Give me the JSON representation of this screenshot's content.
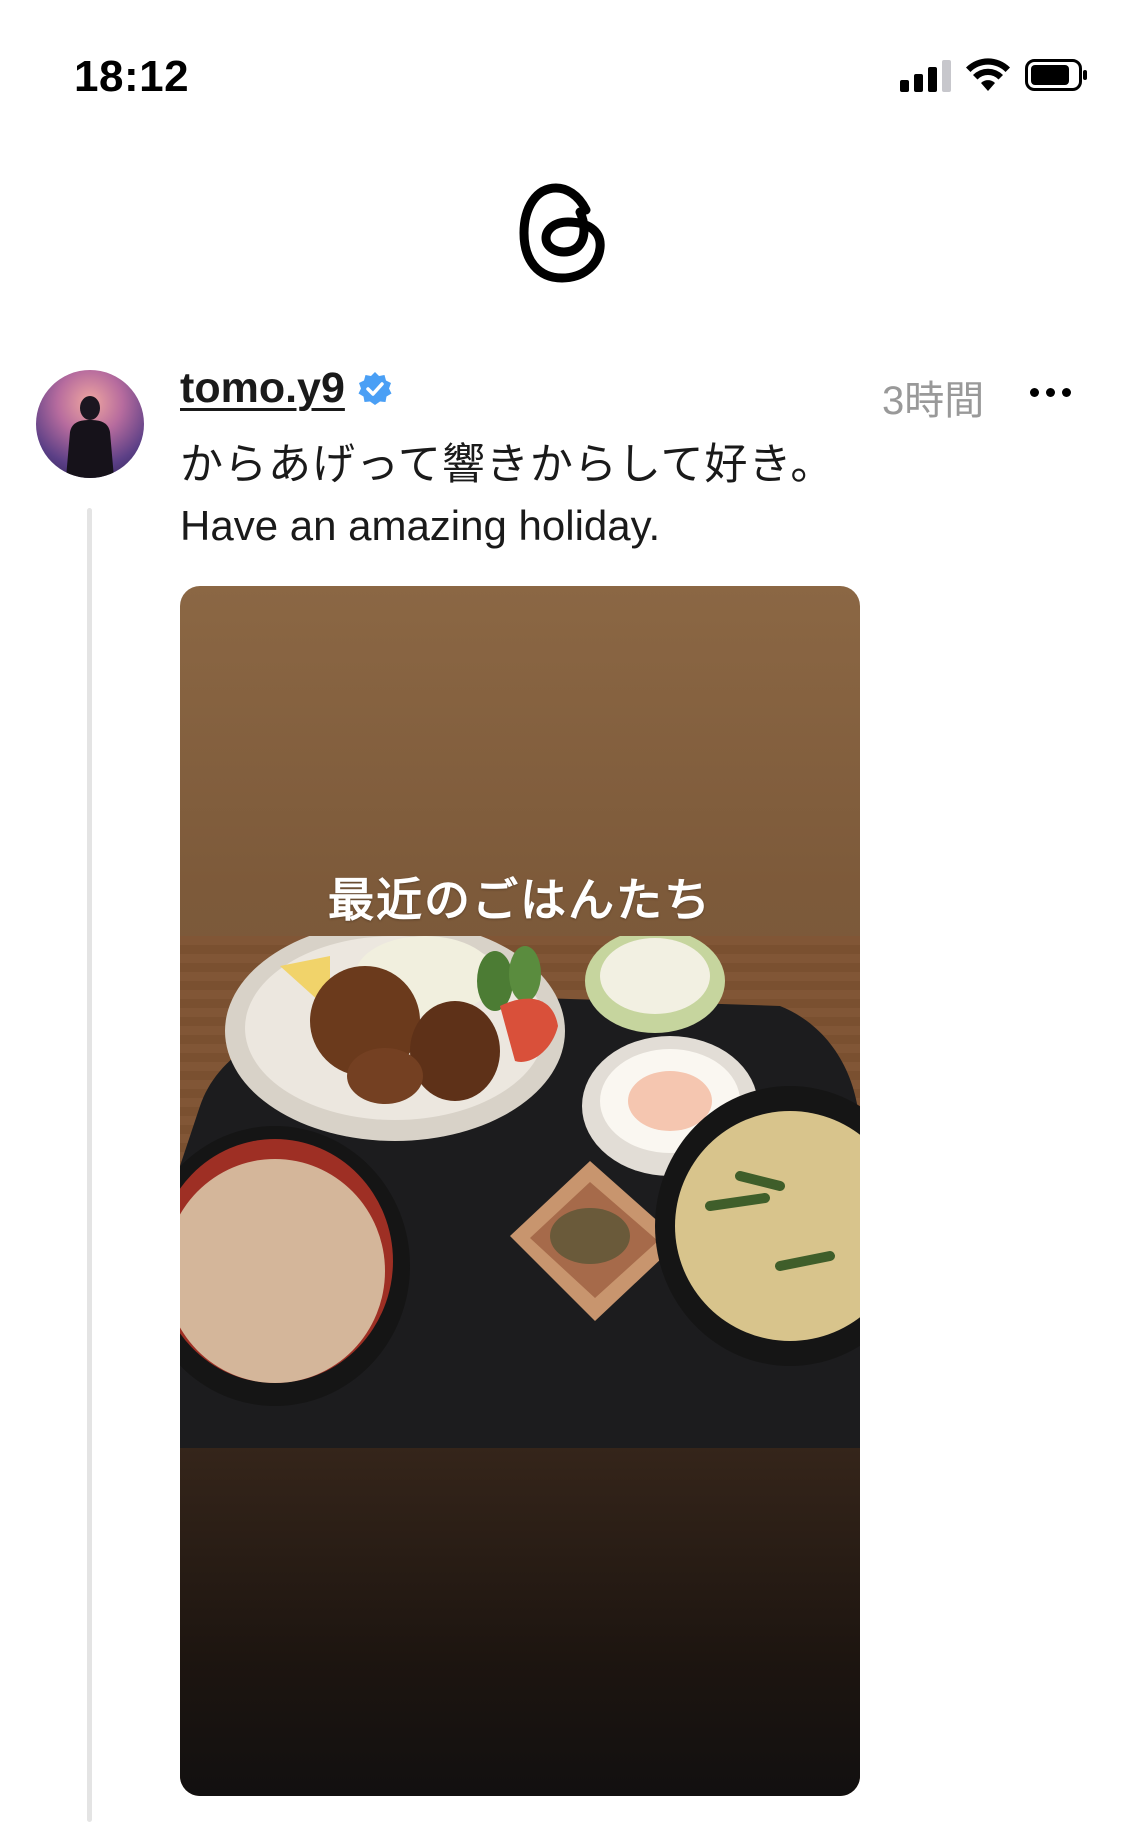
{
  "status_bar": {
    "time": "18:12",
    "icons": [
      "cellular-signal-icon",
      "wifi-icon",
      "battery-icon"
    ]
  },
  "app": {
    "logo": "threads-logo-icon"
  },
  "post": {
    "username": "tomo.y9",
    "verified": true,
    "verified_color": "#4a9ff5",
    "timestamp": "3時間",
    "text_line_1": "からあげって響きからして好き。",
    "text_line_2": "Have an amazing holiday.",
    "media": {
      "caption": "最近のごはんたち"
    }
  },
  "colors": {
    "text": "#1a1a1a",
    "muted": "#999999",
    "thread_line": "#e4e4e4"
  }
}
